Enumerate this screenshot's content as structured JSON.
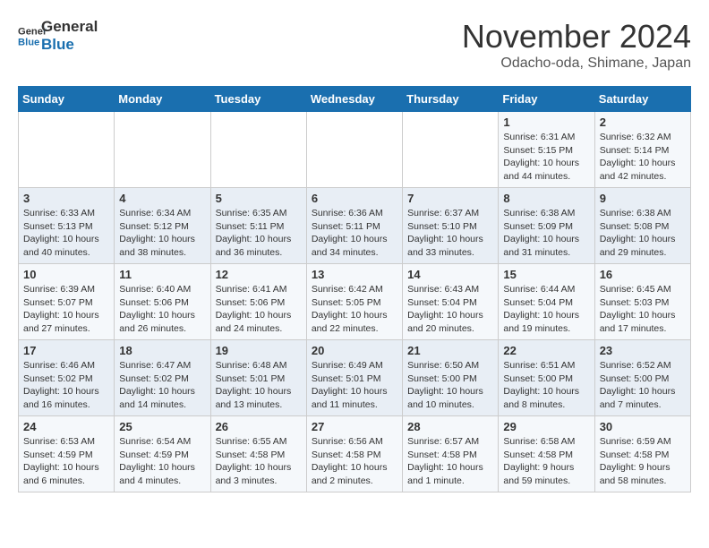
{
  "logo": {
    "line1": "General",
    "line2": "Blue"
  },
  "title": "November 2024",
  "subtitle": "Odacho-oda, Shimane, Japan",
  "headers": [
    "Sunday",
    "Monday",
    "Tuesday",
    "Wednesday",
    "Thursday",
    "Friday",
    "Saturday"
  ],
  "weeks": [
    [
      {
        "day": "",
        "info": ""
      },
      {
        "day": "",
        "info": ""
      },
      {
        "day": "",
        "info": ""
      },
      {
        "day": "",
        "info": ""
      },
      {
        "day": "",
        "info": ""
      },
      {
        "day": "1",
        "info": "Sunrise: 6:31 AM\nSunset: 5:15 PM\nDaylight: 10 hours and 44 minutes."
      },
      {
        "day": "2",
        "info": "Sunrise: 6:32 AM\nSunset: 5:14 PM\nDaylight: 10 hours and 42 minutes."
      }
    ],
    [
      {
        "day": "3",
        "info": "Sunrise: 6:33 AM\nSunset: 5:13 PM\nDaylight: 10 hours and 40 minutes."
      },
      {
        "day": "4",
        "info": "Sunrise: 6:34 AM\nSunset: 5:12 PM\nDaylight: 10 hours and 38 minutes."
      },
      {
        "day": "5",
        "info": "Sunrise: 6:35 AM\nSunset: 5:11 PM\nDaylight: 10 hours and 36 minutes."
      },
      {
        "day": "6",
        "info": "Sunrise: 6:36 AM\nSunset: 5:11 PM\nDaylight: 10 hours and 34 minutes."
      },
      {
        "day": "7",
        "info": "Sunrise: 6:37 AM\nSunset: 5:10 PM\nDaylight: 10 hours and 33 minutes."
      },
      {
        "day": "8",
        "info": "Sunrise: 6:38 AM\nSunset: 5:09 PM\nDaylight: 10 hours and 31 minutes."
      },
      {
        "day": "9",
        "info": "Sunrise: 6:38 AM\nSunset: 5:08 PM\nDaylight: 10 hours and 29 minutes."
      }
    ],
    [
      {
        "day": "10",
        "info": "Sunrise: 6:39 AM\nSunset: 5:07 PM\nDaylight: 10 hours and 27 minutes."
      },
      {
        "day": "11",
        "info": "Sunrise: 6:40 AM\nSunset: 5:06 PM\nDaylight: 10 hours and 26 minutes."
      },
      {
        "day": "12",
        "info": "Sunrise: 6:41 AM\nSunset: 5:06 PM\nDaylight: 10 hours and 24 minutes."
      },
      {
        "day": "13",
        "info": "Sunrise: 6:42 AM\nSunset: 5:05 PM\nDaylight: 10 hours and 22 minutes."
      },
      {
        "day": "14",
        "info": "Sunrise: 6:43 AM\nSunset: 5:04 PM\nDaylight: 10 hours and 20 minutes."
      },
      {
        "day": "15",
        "info": "Sunrise: 6:44 AM\nSunset: 5:04 PM\nDaylight: 10 hours and 19 minutes."
      },
      {
        "day": "16",
        "info": "Sunrise: 6:45 AM\nSunset: 5:03 PM\nDaylight: 10 hours and 17 minutes."
      }
    ],
    [
      {
        "day": "17",
        "info": "Sunrise: 6:46 AM\nSunset: 5:02 PM\nDaylight: 10 hours and 16 minutes."
      },
      {
        "day": "18",
        "info": "Sunrise: 6:47 AM\nSunset: 5:02 PM\nDaylight: 10 hours and 14 minutes."
      },
      {
        "day": "19",
        "info": "Sunrise: 6:48 AM\nSunset: 5:01 PM\nDaylight: 10 hours and 13 minutes."
      },
      {
        "day": "20",
        "info": "Sunrise: 6:49 AM\nSunset: 5:01 PM\nDaylight: 10 hours and 11 minutes."
      },
      {
        "day": "21",
        "info": "Sunrise: 6:50 AM\nSunset: 5:00 PM\nDaylight: 10 hours and 10 minutes."
      },
      {
        "day": "22",
        "info": "Sunrise: 6:51 AM\nSunset: 5:00 PM\nDaylight: 10 hours and 8 minutes."
      },
      {
        "day": "23",
        "info": "Sunrise: 6:52 AM\nSunset: 5:00 PM\nDaylight: 10 hours and 7 minutes."
      }
    ],
    [
      {
        "day": "24",
        "info": "Sunrise: 6:53 AM\nSunset: 4:59 PM\nDaylight: 10 hours and 6 minutes."
      },
      {
        "day": "25",
        "info": "Sunrise: 6:54 AM\nSunset: 4:59 PM\nDaylight: 10 hours and 4 minutes."
      },
      {
        "day": "26",
        "info": "Sunrise: 6:55 AM\nSunset: 4:58 PM\nDaylight: 10 hours and 3 minutes."
      },
      {
        "day": "27",
        "info": "Sunrise: 6:56 AM\nSunset: 4:58 PM\nDaylight: 10 hours and 2 minutes."
      },
      {
        "day": "28",
        "info": "Sunrise: 6:57 AM\nSunset: 4:58 PM\nDaylight: 10 hours and 1 minute."
      },
      {
        "day": "29",
        "info": "Sunrise: 6:58 AM\nSunset: 4:58 PM\nDaylight: 9 hours and 59 minutes."
      },
      {
        "day": "30",
        "info": "Sunrise: 6:59 AM\nSunset: 4:58 PM\nDaylight: 9 hours and 58 minutes."
      }
    ]
  ]
}
